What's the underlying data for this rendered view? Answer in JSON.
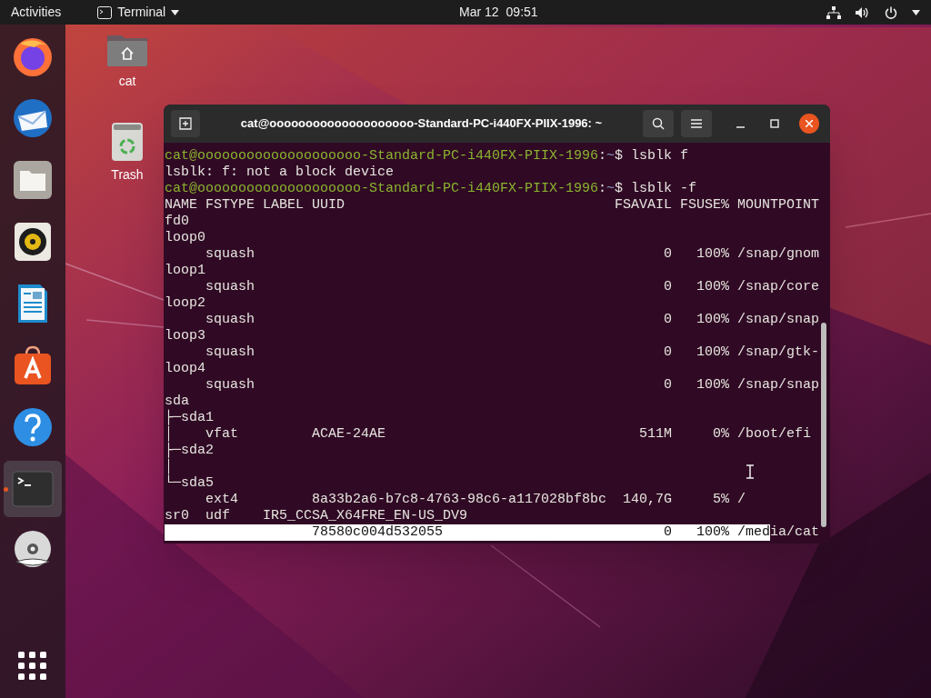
{
  "top_bar": {
    "activities": "Activities",
    "app_menu": {
      "label": "Terminal"
    },
    "clock": {
      "date": "Mar 12",
      "time": "09:51"
    }
  },
  "dock": {
    "items": [
      {
        "kind": "firefox",
        "selected": false,
        "running": false
      },
      {
        "kind": "thunderbird",
        "selected": false,
        "running": false
      },
      {
        "kind": "files",
        "selected": false,
        "running": false
      },
      {
        "kind": "rhythmbox",
        "selected": false,
        "running": false
      },
      {
        "kind": "writer",
        "selected": false,
        "running": false
      },
      {
        "kind": "software",
        "selected": false,
        "running": false
      },
      {
        "kind": "help",
        "selected": false,
        "running": false
      },
      {
        "kind": "terminal",
        "selected": true,
        "running": true
      },
      {
        "kind": "dvd",
        "selected": false,
        "running": false
      }
    ]
  },
  "desktop_icons": [
    {
      "kind": "home",
      "label": "cat"
    },
    {
      "kind": "trash",
      "label": "Trash"
    }
  ],
  "terminal": {
    "title": "cat@oooooooooooooooooooo-Standard-PC-i440FX-PIIX-1996: ~",
    "lines": [
      {
        "kind": "prompt",
        "user_host": "cat@oooooooooooooooooooo-Standard-PC-i440FX-PIIX-1996",
        "separator": ":",
        "path": "~",
        "command": "$ lsblk f"
      },
      {
        "kind": "output",
        "segments": [
          {
            "text": "lsblk: f: not a block device",
            "selected": false
          }
        ]
      },
      {
        "kind": "prompt",
        "user_host": "cat@oooooooooooooooooooo-Standard-PC-i440FX-PIIX-1996",
        "separator": ":",
        "path": "~",
        "command": "$ lsblk -f"
      },
      {
        "kind": "output",
        "segments": [
          {
            "text": "NAME FSTYPE LABEL UUID                                 FSAVAIL FSUSE% MOUNTPOINT",
            "selected": false
          }
        ]
      },
      {
        "kind": "output",
        "segments": [
          {
            "text": "fd0",
            "selected": false
          }
        ]
      },
      {
        "kind": "output",
        "segments": [
          {
            "text": "loop0",
            "selected": false
          }
        ]
      },
      {
        "kind": "output",
        "segments": [
          {
            "text": "     squash                                                  0   100% /snap/gnom",
            "selected": false
          }
        ]
      },
      {
        "kind": "output",
        "segments": [
          {
            "text": "loop1",
            "selected": false
          }
        ]
      },
      {
        "kind": "output",
        "segments": [
          {
            "text": "     squash                                                  0   100% /snap/core",
            "selected": false
          }
        ]
      },
      {
        "kind": "output",
        "segments": [
          {
            "text": "loop2",
            "selected": false
          }
        ]
      },
      {
        "kind": "output",
        "segments": [
          {
            "text": "     squash                                                  0   100% /snap/snap",
            "selected": false
          }
        ]
      },
      {
        "kind": "output",
        "segments": [
          {
            "text": "loop3",
            "selected": false
          }
        ]
      },
      {
        "kind": "output",
        "segments": [
          {
            "text": "     squash                                                  0   100% /snap/gtk-",
            "selected": false
          }
        ]
      },
      {
        "kind": "output",
        "segments": [
          {
            "text": "loop4",
            "selected": false
          }
        ]
      },
      {
        "kind": "output",
        "segments": [
          {
            "text": "     squash                                                  0   100% /snap/snap",
            "selected": false
          }
        ]
      },
      {
        "kind": "output",
        "segments": [
          {
            "text": "sda",
            "selected": false
          }
        ]
      },
      {
        "kind": "output",
        "segments": [
          {
            "text": "├─sda1",
            "selected": false
          }
        ]
      },
      {
        "kind": "output",
        "segments": [
          {
            "text": "│    vfat         ACAE-24AE                               511M     0% /boot/efi",
            "selected": false
          }
        ]
      },
      {
        "kind": "output",
        "segments": [
          {
            "text": "├─sda2",
            "selected": false
          }
        ]
      },
      {
        "kind": "output",
        "segments": [
          {
            "text": "│",
            "selected": false
          }
        ]
      },
      {
        "kind": "output",
        "segments": [
          {
            "text": "└─sda5",
            "selected": false
          }
        ]
      },
      {
        "kind": "output",
        "segments": [
          {
            "text": "     ext4         8a33b2a6-b7c8-4763-98c6-a117028bf8bc  140,7G     5% /",
            "selected": false
          }
        ]
      },
      {
        "kind": "output",
        "segments": [
          {
            "text": "sr0  udf    IR5_CCSA_X64FRE_EN-US_DV9",
            "selected": false
          }
        ]
      },
      {
        "kind": "output",
        "segments": [
          {
            "text": "                  78580c004d532055                           0   100% /med",
            "selected": true
          },
          {
            "text": "ia/cat",
            "selected": false
          }
        ]
      }
    ]
  }
}
